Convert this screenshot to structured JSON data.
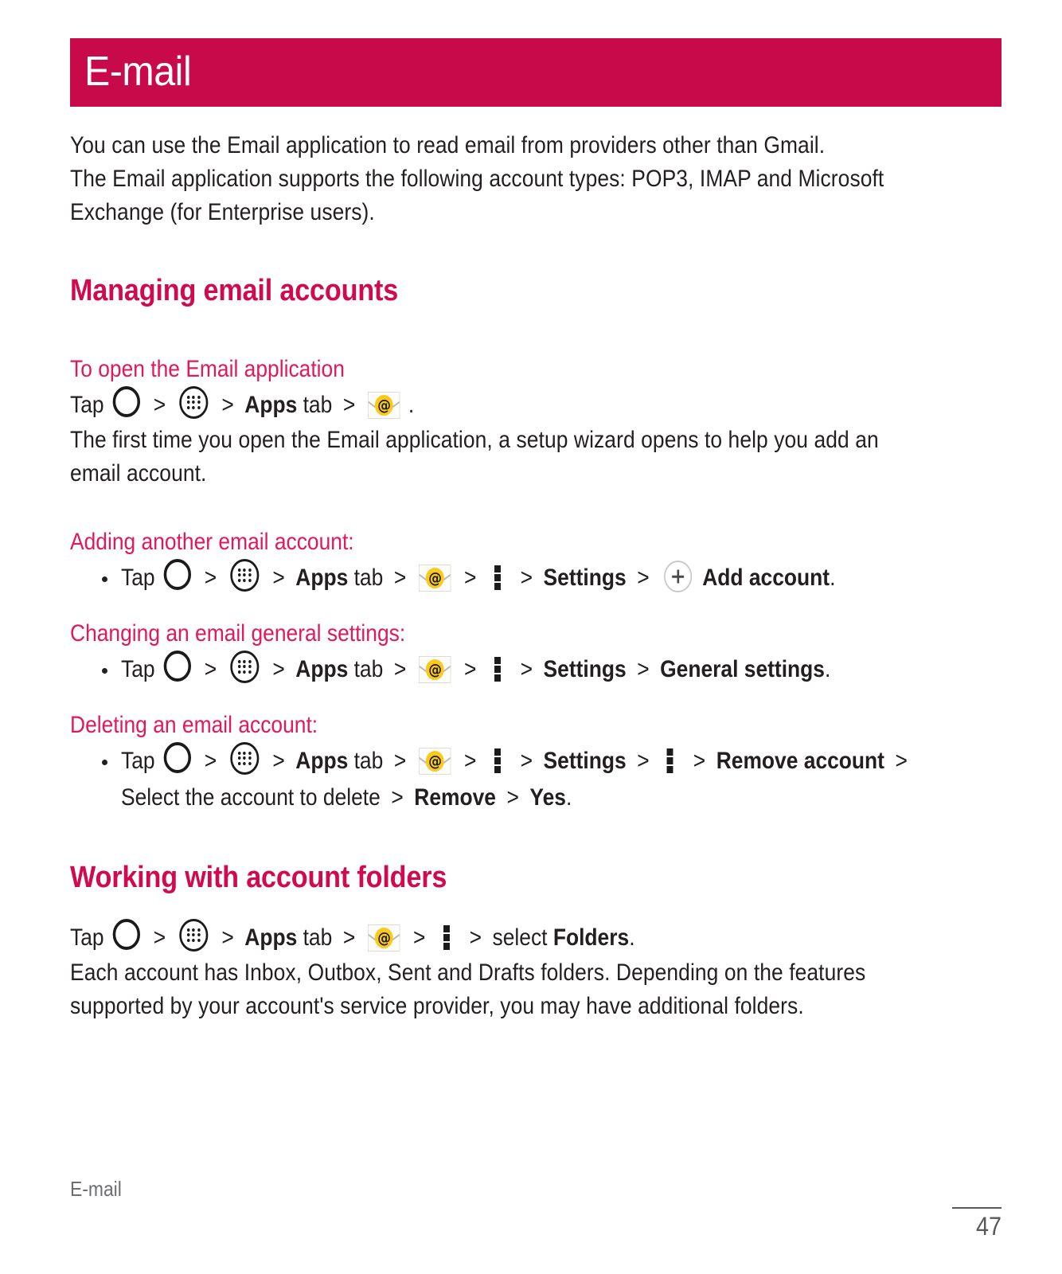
{
  "banner": {
    "title": "E-mail",
    "bg_color": "#c80a4b",
    "text_color": "#ffffff"
  },
  "intro": {
    "line1": "You can use the Email application to read email from providers other than Gmail.",
    "line2": "The Email application supports the following account types: POP3, IMAP and Microsoft",
    "line3": "Exchange (for Enterprise users)."
  },
  "sections": {
    "managing": {
      "heading": "Managing email accounts",
      "color": "#d10a50",
      "open_app": {
        "subhead": "To open the Email application",
        "tap_label": "Tap",
        "apps_label": "Apps",
        "tab_label": "tab",
        "period": ".",
        "note_line1": "The first time you open the Email application, a setup wizard opens to help you add an",
        "note_line2": "email account."
      },
      "adding": {
        "subhead": "Adding another email account:",
        "tap_label": "Tap",
        "apps_label": "Apps",
        "tab_label": "tab",
        "settings_label": "Settings",
        "add_account_label": "Add account",
        "period": "."
      },
      "changing": {
        "subhead": "Changing an email general settings:",
        "tap_label": "Tap",
        "apps_label": "Apps",
        "tab_label": "tab",
        "settings_label": "Settings",
        "general_settings_label": "General settings",
        "period": "."
      },
      "deleting": {
        "subhead": "Deleting an email account:",
        "tap_label": "Tap",
        "apps_label": "Apps",
        "tab_label": "tab",
        "settings_label": "Settings",
        "remove_account_label": "Remove account",
        "select_text": "Select the account to delete",
        "remove_label": "Remove",
        "yes_label": "Yes",
        "period": "."
      }
    },
    "folders": {
      "heading": "Working with account folders",
      "color": "#d10a50",
      "tap_label": "Tap",
      "apps_label": "Apps",
      "tab_label": "tab",
      "select_label": "select",
      "folders_label": "Folders",
      "period": ".",
      "note_line1": "Each account has Inbox, Outbox, Sent and Drafts folders. Depending on the features",
      "note_line2": "supported by your account's service provider, you may have additional folders."
    }
  },
  "separator": ">",
  "icons": {
    "home": "home-circle-icon",
    "apps": "apps-grid-icon",
    "email": "email-envelope-icon",
    "menu": "kebab-menu-icon",
    "plus": "plus-circle-icon",
    "at_glyph": "@"
  },
  "footer": {
    "label": "E-mail",
    "page_number": "47"
  }
}
